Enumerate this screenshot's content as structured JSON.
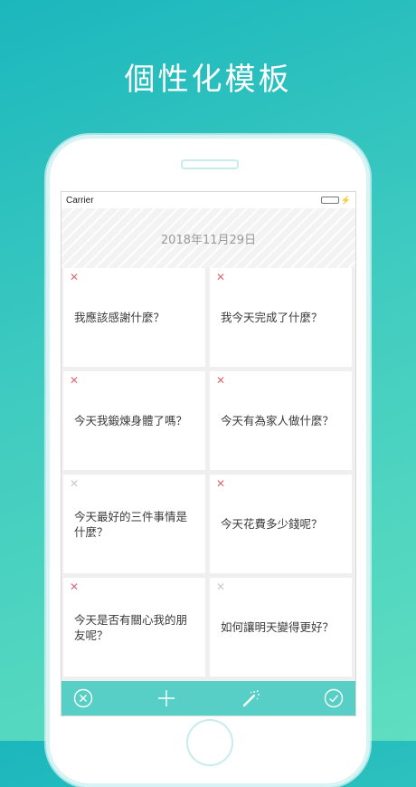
{
  "headline": "個性化模板",
  "status_bar": {
    "carrier": "Carrier"
  },
  "journal": {
    "date": "2018年11月29日",
    "cards": [
      {
        "question": "我應該感謝什麼？",
        "delete_active": true
      },
      {
        "question": "我今天完成了什麼？",
        "delete_active": true
      },
      {
        "question": "今天我鍛煉身體了嗎？",
        "delete_active": true
      },
      {
        "question": "今天有為家人做什麼？",
        "delete_active": true
      },
      {
        "question": "今天最好的三件事情是什麼？",
        "delete_active": false
      },
      {
        "question": "今天花費多少錢呢？",
        "delete_active": true
      },
      {
        "question": "今天是否有關心我的朋友呢？",
        "delete_active": true
      },
      {
        "question": "如何讓明天變得更好？",
        "delete_active": false
      }
    ]
  },
  "toolbar": {
    "icons": [
      "cancel-circle-icon",
      "plus-icon",
      "magic-wand-icon",
      "confirm-check-icon"
    ]
  },
  "colors": {
    "accent": "#57cfc6",
    "delete_active": "#e06a78",
    "delete_inactive": "#c9c9c9",
    "battery": "#3cc34a"
  }
}
